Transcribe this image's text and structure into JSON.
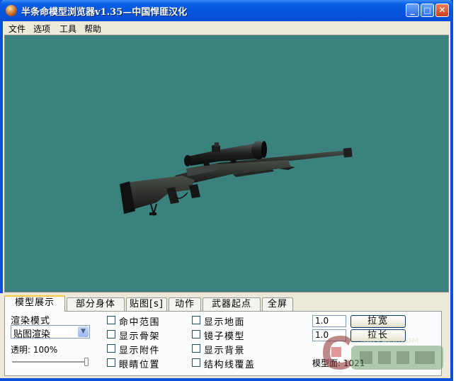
{
  "window": {
    "title": "半条命模型浏览器v1.35—中国悍匪汉化",
    "minimize_label": "_",
    "maximize_label": "□",
    "close_label": "✕"
  },
  "menu": [
    "文件",
    "选项",
    "工具",
    "帮助"
  ],
  "tabs": [
    "模型展示",
    "部分身体",
    "贴图[s]",
    "动作",
    "武器起点",
    "全屏"
  ],
  "active_tab": "模型展示",
  "render": {
    "mode_label": "渲染模式",
    "mode_value": "贴图渲染",
    "transparency_label": "透明: 100%",
    "transparency": 1.0
  },
  "checkboxes_col1": [
    "命中范围",
    "显示骨架",
    "显示附件",
    "眼睛位置"
  ],
  "checkboxes_col2": [
    "显示地面",
    "镜子模型",
    "显示背景",
    "结构线覆盖"
  ],
  "scale": {
    "width_value": "1.0",
    "height_value": "1.0",
    "width_button": "拉宽",
    "height_button": "拉长"
  },
  "model_faces_label": "模型面: 1021",
  "watermark_text": "SOFPACK.COM",
  "colors": {
    "title_bar": "#0a4fd8",
    "viewport_bg": "#3b827f",
    "active_tab_accent": "#ffc83c"
  },
  "icons": [
    "app-icon",
    "minimize-icon",
    "maximize-icon",
    "close-icon",
    "dropdown-arrow-icon"
  ]
}
